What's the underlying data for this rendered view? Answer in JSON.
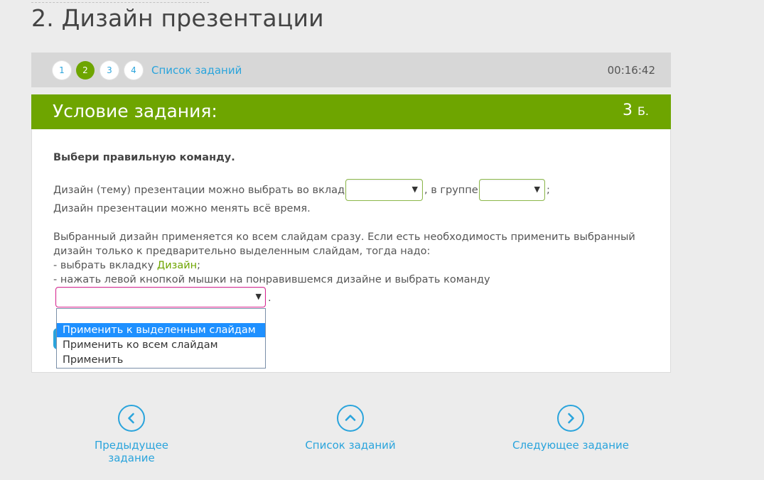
{
  "page": {
    "title": "2. Дизайн презентации"
  },
  "task_nav": {
    "steps": [
      "1",
      "2",
      "3",
      "4"
    ],
    "active_step": "2",
    "task_list_label": "Список заданий",
    "timer": "00:16:42"
  },
  "condition": {
    "title": "Условие задания:",
    "score": "3",
    "score_unit": "Б."
  },
  "content": {
    "instruction": "Выбери правильную команду.",
    "line1_part1": "Дизайн (тему) презентации можно выбрать во вкладке",
    "line1_part2": ", в группе",
    "line1_end": ";",
    "line2": "Дизайн презентации можно менять всё время.",
    "p2_line1": "Выбранный дизайн применяется ко всем слайдам сразу. Если есть необходимость применить выбранный",
    "p2_line2": "дизайн только к предварительно выделенным слайдам, тогда надо:",
    "p2_line3_prefix": "- выбрать вкладку ",
    "p2_line3_highlight": "Дизайн",
    "p2_line3_suffix": ";",
    "p2_line4": "- нажать левой кнопкой мышки на понравившемся дизайне и выбрать команду",
    "p2_line5_end": "."
  },
  "selects": {
    "tab_value": "",
    "group_value": "",
    "command_value": ""
  },
  "dropdown": {
    "options": [
      "",
      "Применить к выделенным слайдам",
      "Применить ко всем слайдам",
      "Применить"
    ],
    "highlighted": "Применить к выделенным слайдам"
  },
  "footer_nav": {
    "prev_label": "Предыдущее задание",
    "list_label": "Список заданий",
    "next_label": "Следующее задание"
  },
  "colors": {
    "accent_green": "#6ea500",
    "link_blue": "#2aa4dc",
    "select_focus": "#d8238f"
  },
  "icons": {
    "prev": "chevron-left-circle-icon",
    "list": "chevron-up-circle-icon",
    "next": "chevron-right-circle-icon",
    "dropdown_arrow": "triangle-down-icon"
  }
}
